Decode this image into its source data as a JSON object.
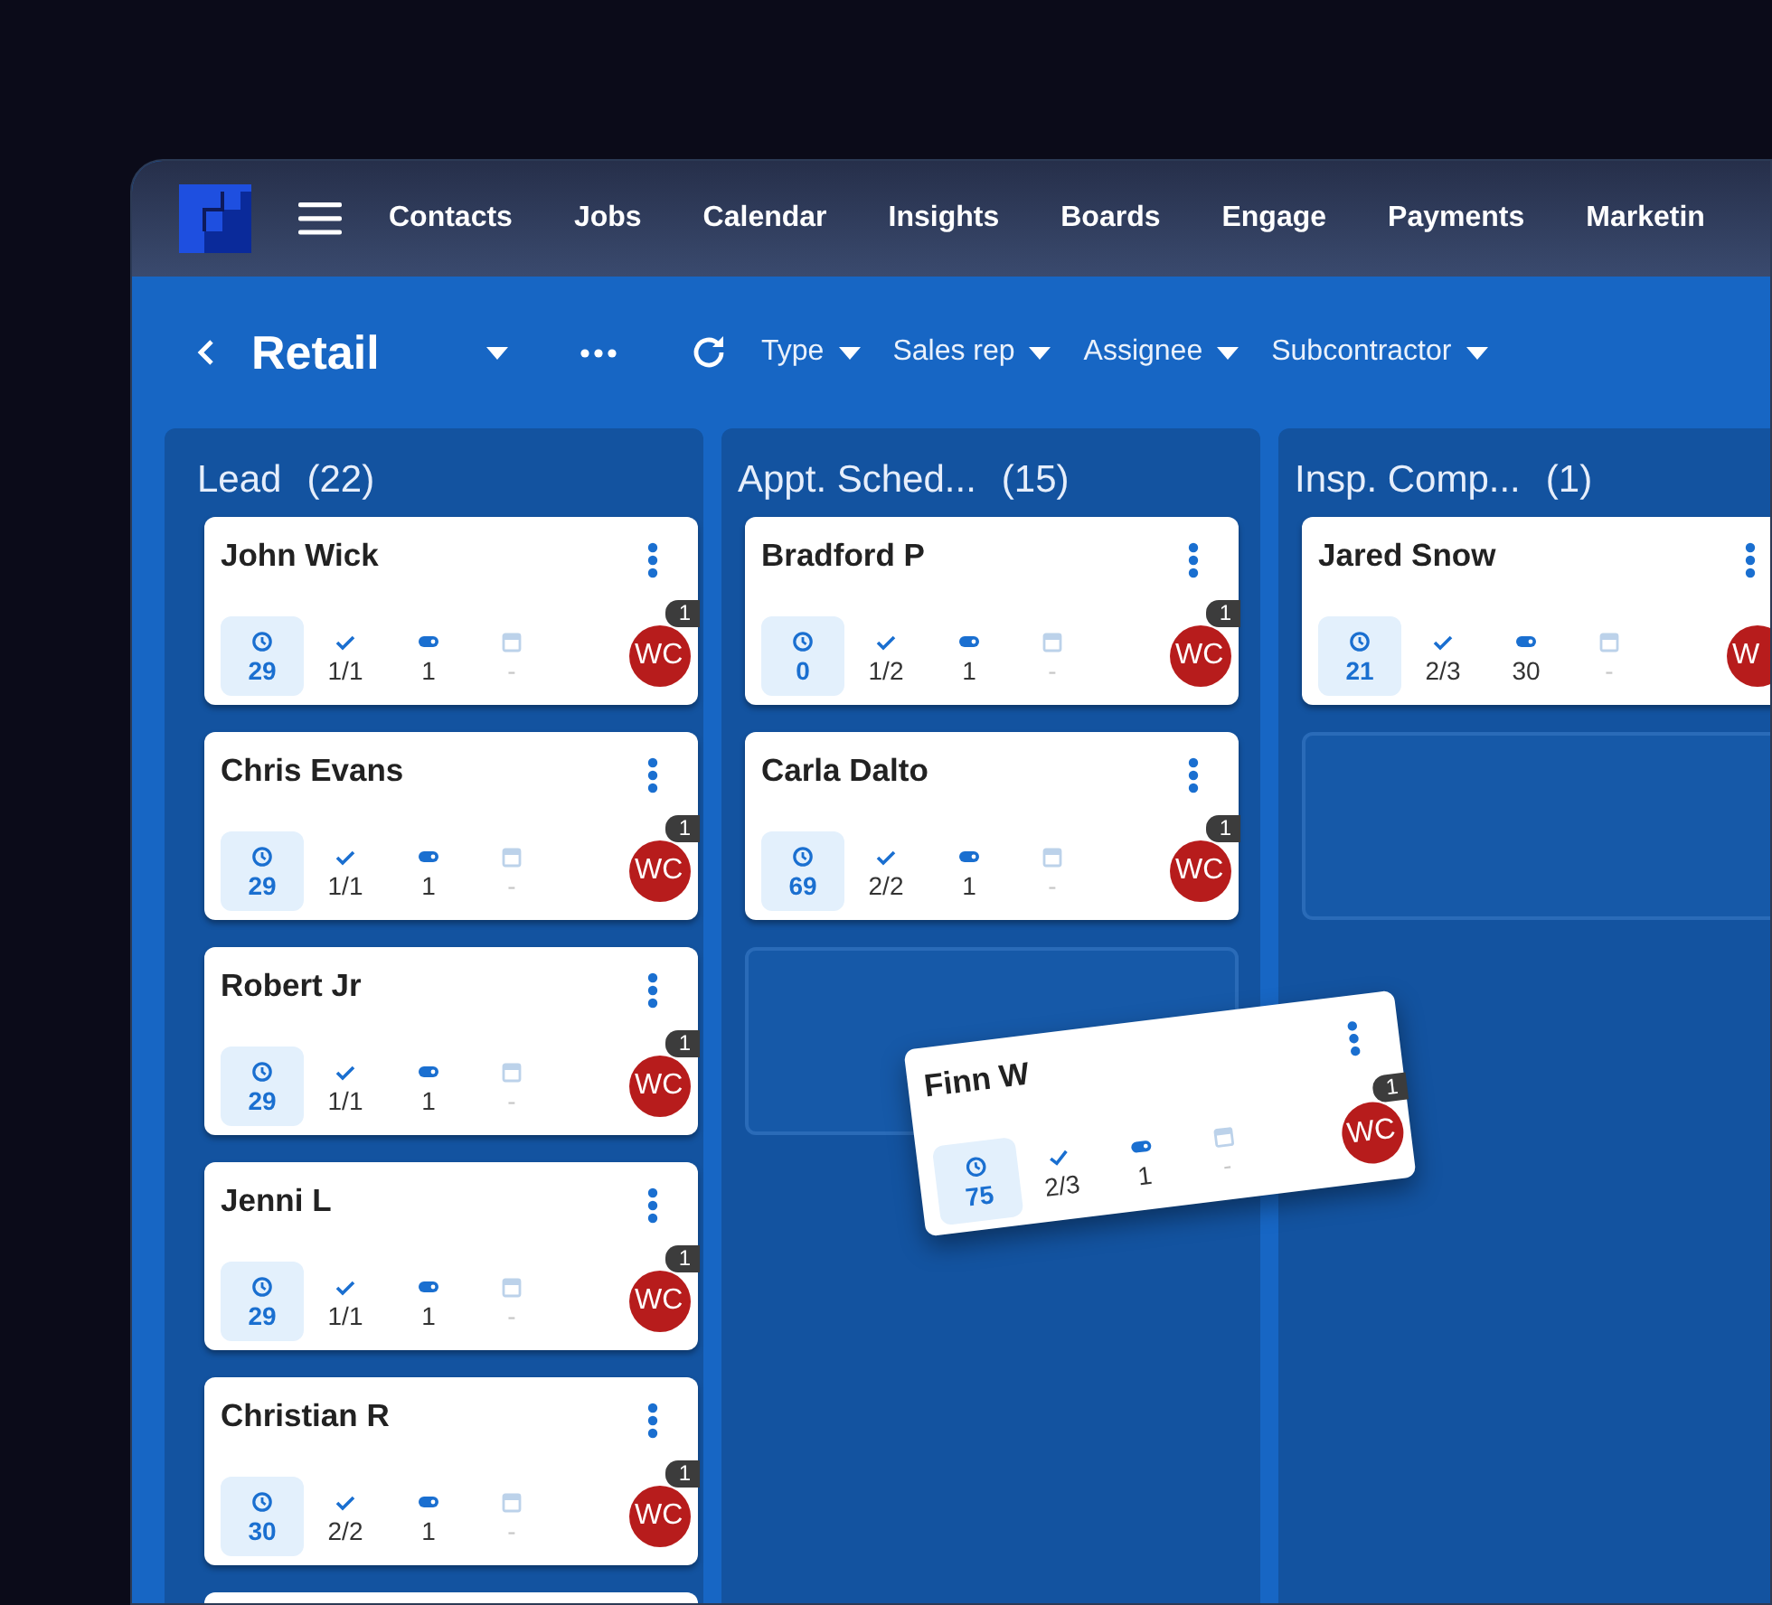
{
  "nav": {
    "items": [
      "Contacts",
      "Jobs",
      "Calendar",
      "Insights",
      "Boards",
      "Engage",
      "Payments",
      "Marketin"
    ]
  },
  "toolbar": {
    "title": "Retail",
    "filters": [
      "Type",
      "Sales rep",
      "Assignee",
      "Subcontractor"
    ]
  },
  "columns": [
    {
      "title": "Lead",
      "count": "(22)",
      "drop_zone": false,
      "more_below": true,
      "cards": [
        {
          "name": "John Wick",
          "time": "29",
          "tasks": "1/1",
          "tags": "1",
          "date": "-",
          "avatar": "WC",
          "badge": "1"
        },
        {
          "name": "Chris Evans",
          "time": "29",
          "tasks": "1/1",
          "tags": "1",
          "date": "-",
          "avatar": "WC",
          "badge": "1"
        },
        {
          "name": "Robert Jr",
          "time": "29",
          "tasks": "1/1",
          "tags": "1",
          "date": "-",
          "avatar": "WC",
          "badge": "1"
        },
        {
          "name": "Jenni L",
          "time": "29",
          "tasks": "1/1",
          "tags": "1",
          "date": "-",
          "avatar": "WC",
          "badge": "1"
        },
        {
          "name": "Christian R",
          "time": "30",
          "tasks": "2/2",
          "tags": "1",
          "date": "-",
          "avatar": "WC",
          "badge": "1"
        }
      ]
    },
    {
      "title": "Appt. Sched...",
      "count": "(15)",
      "drop_zone": true,
      "more_below": false,
      "cards": [
        {
          "name": "Bradford P",
          "time": "0",
          "tasks": "1/2",
          "tags": "1",
          "date": "-",
          "avatar": "WC",
          "badge": "1"
        },
        {
          "name": "Carla Dalto",
          "time": "69",
          "tasks": "2/2",
          "tags": "1",
          "date": "-",
          "avatar": "WC",
          "badge": "1"
        }
      ]
    },
    {
      "title": "Insp. Comp...",
      "count": "(1)",
      "drop_zone": true,
      "more_below": false,
      "cards": [
        {
          "name": "Jared Snow",
          "time": "21",
          "tasks": "2/3",
          "tags": "30",
          "date": "-",
          "avatar": "W"
        }
      ]
    }
  ],
  "dragged_card": {
    "name": "Finn W",
    "time": "75",
    "tasks": "2/3",
    "tags": "1",
    "date": "-",
    "avatar": "WC",
    "badge": "1"
  }
}
